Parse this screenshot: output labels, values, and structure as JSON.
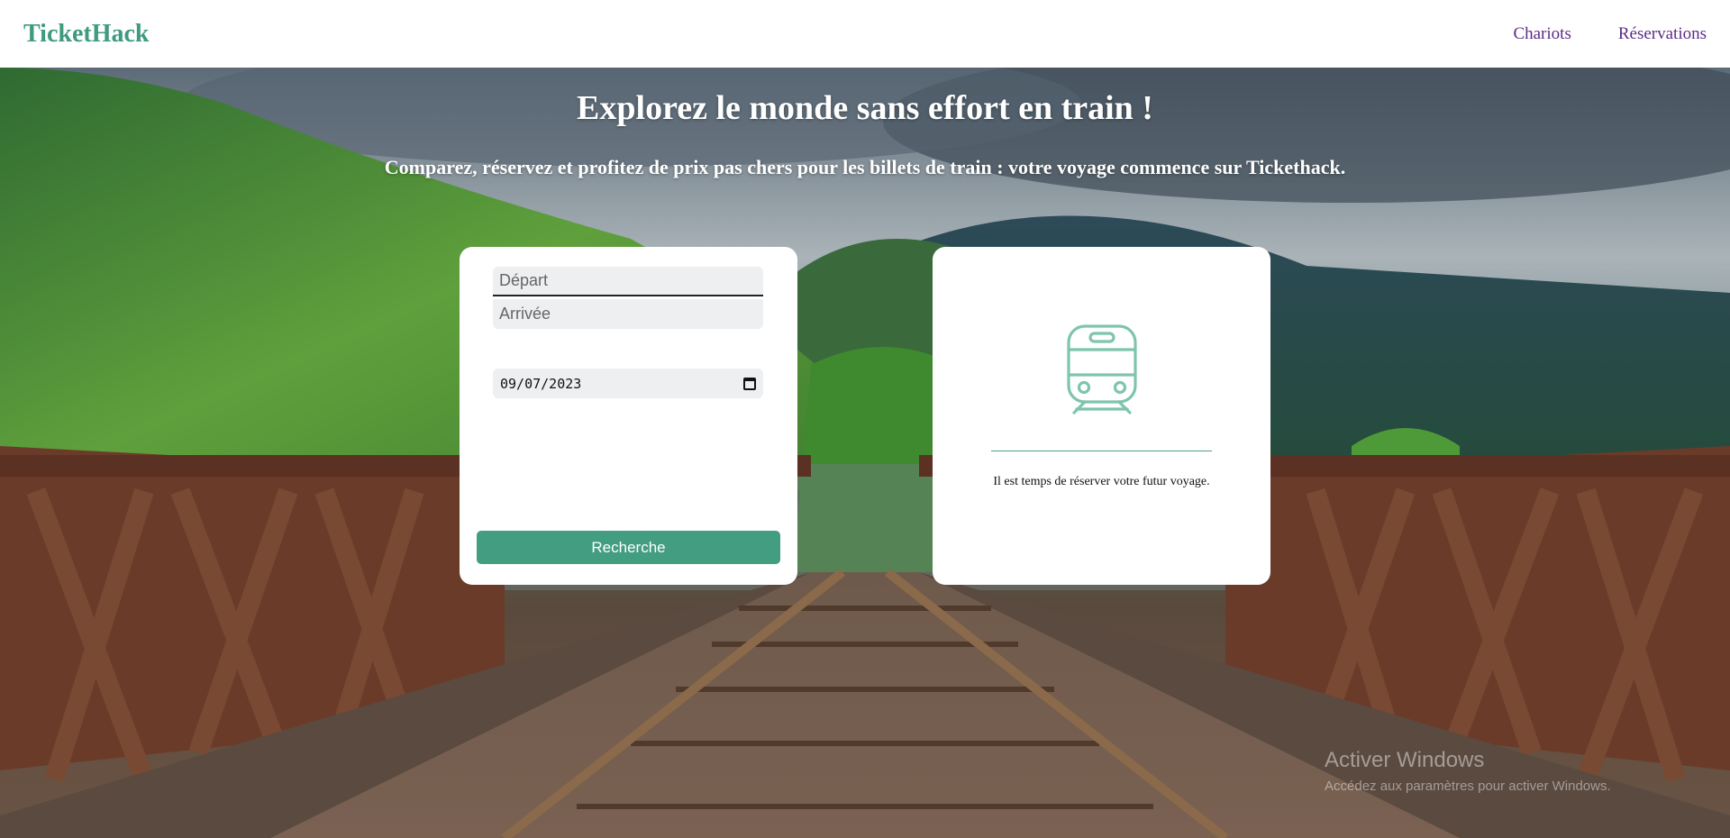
{
  "header": {
    "brand": "TicketHack",
    "nav": {
      "cart": "Chariots",
      "bookings": "Réservations"
    }
  },
  "hero": {
    "title": "Explorez le monde sans effort en train !",
    "subtitle": "Comparez, réservez et profitez de prix pas chers pour les billets de train : votre voyage commence sur Tickethack."
  },
  "search": {
    "departure_placeholder": "Départ",
    "arrival_placeholder": "Arrivée",
    "date_value": "09/07/2023",
    "button_label": "Recherche"
  },
  "result": {
    "icon": "train-icon",
    "message": "Il est temps de réserver votre futur voyage."
  },
  "watermark": {
    "title": "Activer Windows",
    "subtitle": "Accédez aux paramètres pour activer Windows."
  },
  "colors": {
    "brand": "#3f9a80",
    "nav_link": "#5b2a86",
    "button": "#439d80"
  }
}
